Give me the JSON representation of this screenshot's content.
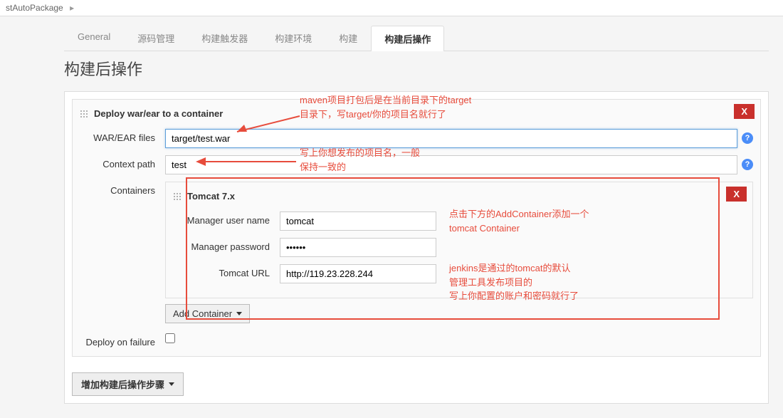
{
  "breadcrumb": {
    "item": "stAutoPackage"
  },
  "tabs": [
    {
      "label": "General",
      "active": false
    },
    {
      "label": "源码管理",
      "active": false
    },
    {
      "label": "构建触发器",
      "active": false
    },
    {
      "label": "构建环境",
      "active": false
    },
    {
      "label": "构建",
      "active": false
    },
    {
      "label": "构建后操作",
      "active": true
    }
  ],
  "section_title": "构建后操作",
  "deploy": {
    "header": "Deploy war/ear to a container",
    "war_label": "WAR/EAR files",
    "war_value": "target/test.war",
    "context_label": "Context path",
    "context_value": "test",
    "containers_label": "Containers",
    "close_label": "X",
    "add_container_label": "Add Container",
    "deploy_failure_label": "Deploy on failure"
  },
  "tomcat": {
    "header": "Tomcat 7.x",
    "close_label": "X",
    "user_label": "Manager user name",
    "user_value": "tomcat",
    "pass_label": "Manager password",
    "pass_value": "••••••",
    "url_label": "Tomcat URL",
    "url_value": "http://119.23.228.244"
  },
  "add_step_label": "增加构建后操作步骤",
  "annotations": {
    "a1_line1": "maven项目打包后是在当前目录下的target",
    "a1_line2": "目录下，写target/你的项目名就行了",
    "a2_line1": "写上你想发布的项目名，一般",
    "a2_line2": "保持一致的",
    "a3_line1": "点击下方的AddContainer添加一个",
    "a3_line2": "tomcat Container",
    "a4_line1": "jenkins是通过的tomcat的默认",
    "a4_line2": "管理工具发布项目的",
    "a4_line3": "写上你配置的账户和密码就行了"
  }
}
